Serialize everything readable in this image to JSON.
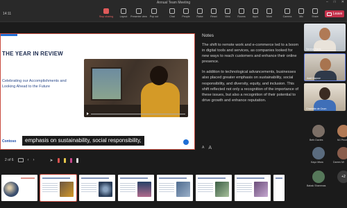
{
  "window": {
    "title": "Annual Team Meeting"
  },
  "meeting": {
    "timer": "14:11"
  },
  "toolbar": {
    "items": [
      {
        "label": "Stop sharing",
        "icon": "stop-share-icon"
      },
      {
        "label": "Layout",
        "icon": "layout-icon"
      },
      {
        "label": "Presenter view",
        "icon": "presenter-view-icon"
      },
      {
        "label": "Pop out",
        "icon": "pop-out-icon"
      },
      {
        "label": "Chat",
        "icon": "chat-icon"
      },
      {
        "label": "People",
        "icon": "people-icon"
      },
      {
        "label": "Raise",
        "icon": "raise-hand-icon"
      },
      {
        "label": "React",
        "icon": "react-icon"
      },
      {
        "label": "View",
        "icon": "view-icon"
      },
      {
        "label": "Rooms",
        "icon": "rooms-icon"
      },
      {
        "label": "Apps",
        "icon": "apps-icon"
      },
      {
        "label": "More",
        "icon": "more-icon"
      },
      {
        "label": "Camera",
        "icon": "camera-icon"
      },
      {
        "label": "Mic",
        "icon": "mic-icon"
      },
      {
        "label": "Share",
        "icon": "share-icon"
      }
    ],
    "leave_label": "Leave"
  },
  "slide": {
    "title": "THE YEAR IN REVIEW",
    "subtitle": "Celebrating our Accomplishments and Looking Ahead to the Future",
    "logo_text": "Contoso",
    "caption": "emphasis on sustainability, social responsibility,"
  },
  "notes": {
    "heading": "Notes",
    "paragraphs": [
      "The shift to remote work and e-commerce led to a boom in digital tools and services, as companies looked for new ways to reach customers and enhance their online presence.",
      "In addition to technological advancements, businesses also placed greater emphasis on sustainability, social responsibility, and diversity, equity, and inclusion. This shift reflected not only a recognition of the importance of these issues, but also a recognition of their potential to drive growth and enhance reputation."
    ],
    "font_decrease": "A",
    "font_increase": "A"
  },
  "slide_nav": {
    "counter": "2 of 6"
  },
  "participants": {
    "video": [
      {
        "name": "Serena Davis"
      },
      {
        "name": "Aadi Kapoor"
      },
      {
        "name": "Charlotte de Crum"
      }
    ],
    "avatars": [
      {
        "name": "Beth Davies"
      },
      {
        "name": "MJ Price"
      },
      {
        "name": "Kayo Miwa"
      },
      {
        "name": "Darren Mi"
      },
      {
        "name": "Babak Shammas"
      }
    ],
    "more_count": "+2"
  },
  "thumbnails": [
    {
      "title": "Annual Team Meeting"
    },
    {
      "title": "The Year in Review"
    },
    {
      "title": "Slide 3"
    },
    {
      "title": "Slide 4"
    },
    {
      "title": "Slide 5"
    },
    {
      "title": "Slide 6"
    },
    {
      "title": "Slide 7"
    },
    {
      "title": "Slide 8"
    }
  ]
}
